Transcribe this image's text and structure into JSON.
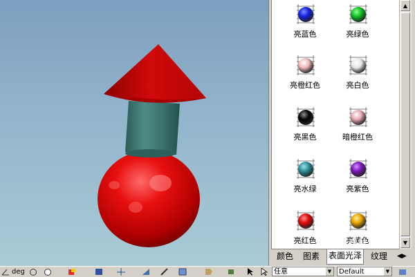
{
  "palette": {
    "swatches": [
      {
        "label": "亮蓝色",
        "color": "#1020e0",
        "highlight": "#8090ff"
      },
      {
        "label": "亮绿色",
        "color": "#10c020",
        "highlight": "#90ff90"
      },
      {
        "label": "亮橙红色",
        "color": "#f0b8b8",
        "highlight": "#ffffff"
      },
      {
        "label": "亮白色",
        "color": "#e8e8e8",
        "highlight": "#ffffff"
      },
      {
        "label": "亮黑色",
        "color": "#050505",
        "highlight": "#909090"
      },
      {
        "label": "暗橙红色",
        "color": "#e8a8b0",
        "highlight": "#ffffff"
      },
      {
        "label": "亮水绿",
        "color": "#2a9098",
        "highlight": "#a0e0e8"
      },
      {
        "label": "亮紫色",
        "color": "#7a18b8",
        "highlight": "#d090ff"
      },
      {
        "label": "亮红色",
        "color": "#e00808",
        "highlight": "#ff9090"
      },
      {
        "label": "亮黄色",
        "color": "#e8a000",
        "highlight": "#fff090"
      }
    ]
  },
  "tabs": [
    {
      "label": "颜色",
      "active": false
    },
    {
      "label": "图素",
      "active": false
    },
    {
      "label": "表面光泽",
      "active": true
    },
    {
      "label": "纹理",
      "active": false
    }
  ],
  "toolbar": {
    "unit_label": "deg",
    "select_mode": "任意",
    "style_value": "Default"
  },
  "watermark": "Bai du 经验",
  "scene": {
    "cone_color": "#c8080a",
    "cylinder_color": "#3f7a76",
    "sphere_color": "#d40808"
  }
}
